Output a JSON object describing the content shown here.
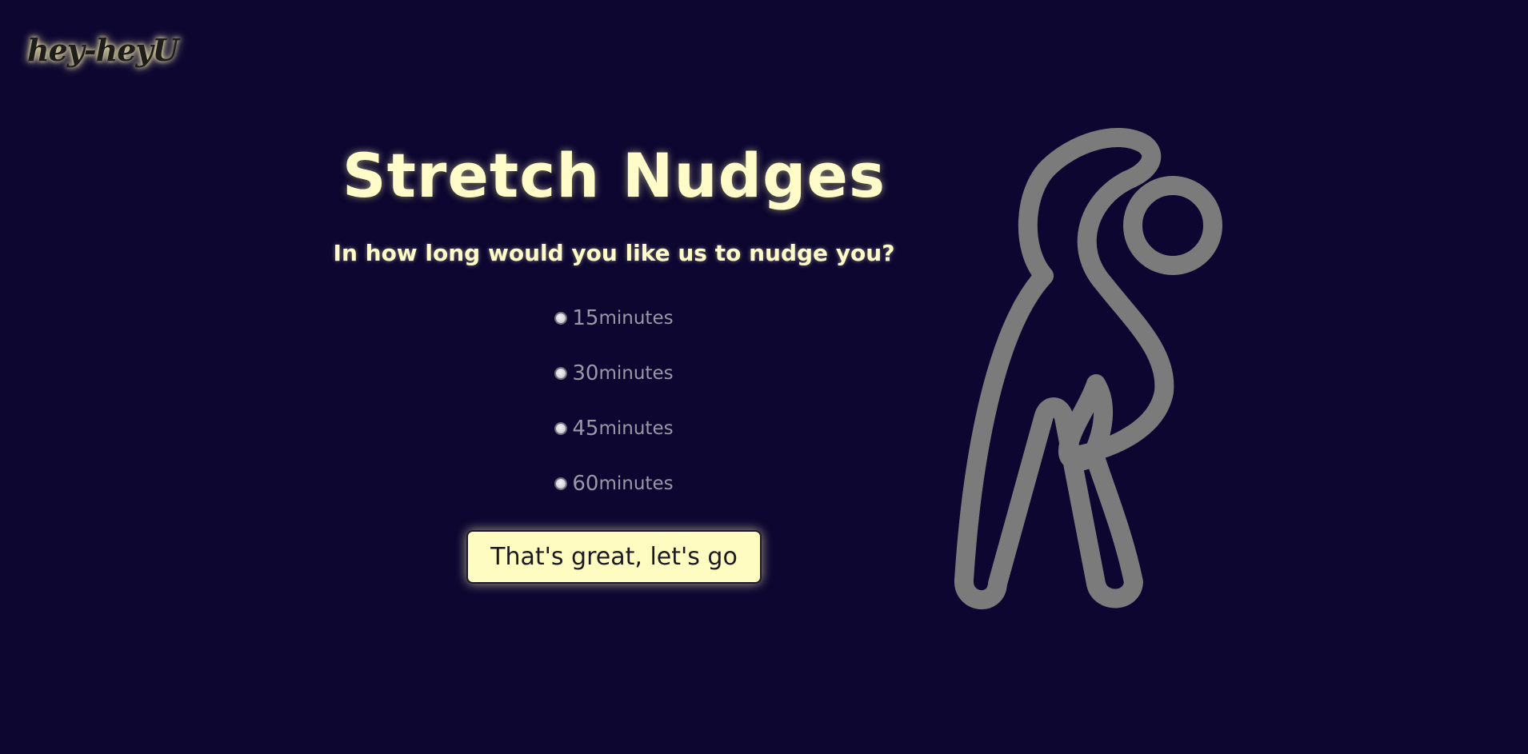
{
  "app": {
    "logo": "hey-heyU"
  },
  "main": {
    "title": "Stretch Nudges",
    "question": "In how long would you like us to nudge you?",
    "options": [
      {
        "value": "15",
        "unit": "minutes"
      },
      {
        "value": "30",
        "unit": "minutes"
      },
      {
        "value": "45",
        "unit": "minutes"
      },
      {
        "value": "60",
        "unit": "minutes"
      }
    ],
    "submit_label": "That's great, let's go"
  },
  "illustration": {
    "icon": "stretching-person-icon",
    "color": "#7b7b7b"
  },
  "colors": {
    "background": "#0c0630",
    "accent": "#fffcc9",
    "button": "#fffcc2",
    "muted_text": "#9b98a6"
  }
}
